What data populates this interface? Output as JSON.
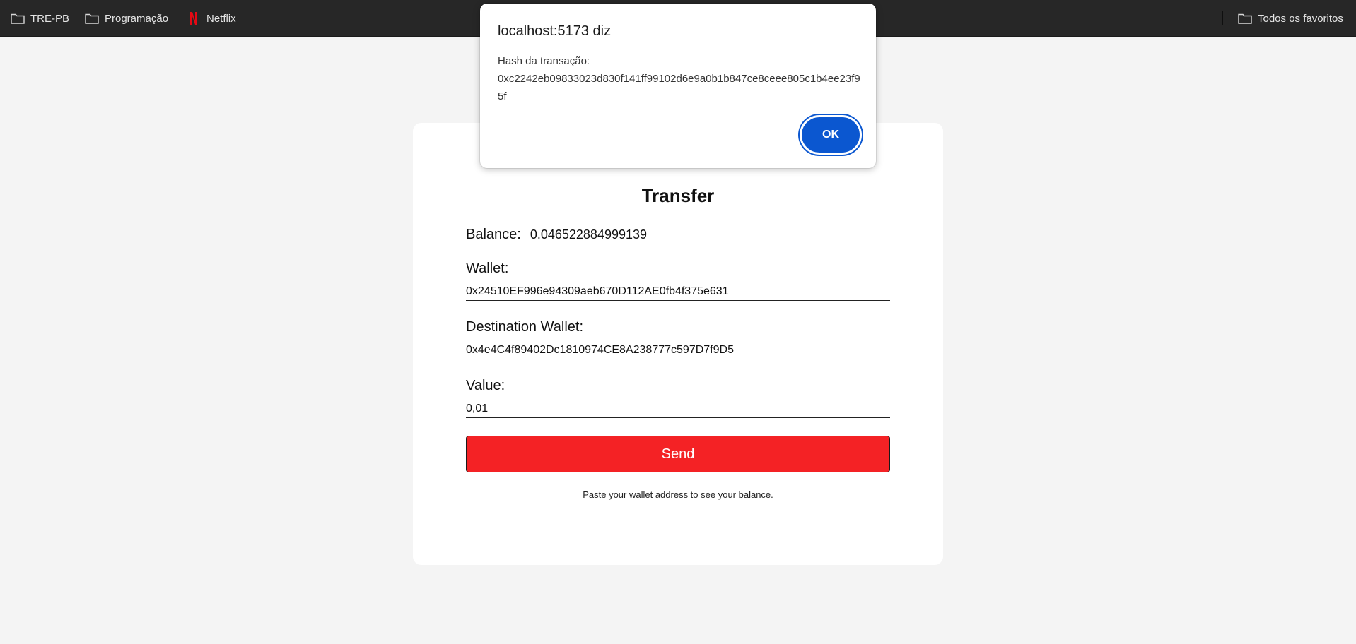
{
  "bookmarks": {
    "items": [
      {
        "label": "TRE-PB",
        "icon": "folder-icon"
      },
      {
        "label": "Programação",
        "icon": "folder-icon"
      },
      {
        "label": "Netflix",
        "icon": "netflix-icon"
      }
    ],
    "all_bookmarks": {
      "label": "Todos os favoritos",
      "icon": "folder-icon"
    }
  },
  "transfer": {
    "title": "Transfer",
    "balance_label": "Balance:",
    "balance_value": "0.046522884999139",
    "wallet_label": "Wallet:",
    "wallet_value": "0x24510EF996e94309aeb670D112AE0fb4f375e631",
    "destination_label": "Destination Wallet:",
    "destination_value": "0x4e4C4f89402Dc1810974CE8A238777c597D7f9D5",
    "value_label": "Value:",
    "value_value": "0,01",
    "send_label": "Send",
    "hint": "Paste your wallet address to see your balance."
  },
  "dialog": {
    "title": "localhost:5173 diz",
    "message_line1": "Hash da transação:",
    "message_hash": "0xc2242eb09833023d830f141ff99102d6e9a0b1b847ce8ceee805c1b4ee23f95f",
    "ok_label": "OK"
  },
  "colors": {
    "send_button": "#f42225",
    "ok_button": "#0b57d0",
    "bookmarks_bar": "#272727",
    "page_background": "#f4f4f4"
  }
}
